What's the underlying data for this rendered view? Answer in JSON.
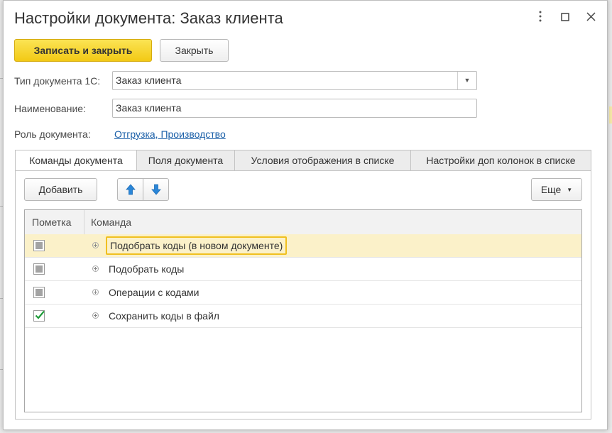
{
  "window": {
    "title": "Настройки документа: Заказ клиента",
    "more_icon": "vertical-dots",
    "maximize_icon": "square",
    "close_icon": "x"
  },
  "toolbar": {
    "save_close_label": "Записать и закрыть",
    "close_label": "Закрыть"
  },
  "form": {
    "doc_type_label": "Тип документа 1С:",
    "doc_type_value": "Заказ клиента",
    "name_label": "Наименование:",
    "name_value": "Заказ клиента",
    "role_label": "Роль документа:",
    "role_value": "Отгрузка, Производство"
  },
  "tabs": [
    {
      "label": "Команды документа",
      "active": true
    },
    {
      "label": "Поля документа",
      "active": false
    },
    {
      "label": "Условия отображения в списке",
      "active": false
    },
    {
      "label": "Настройки доп колонок в списке",
      "active": false
    }
  ],
  "commands_toolbar": {
    "add_label": "Добавить",
    "up_icon": "arrow-up",
    "down_icon": "arrow-down",
    "more_label": "Еще"
  },
  "grid": {
    "columns": [
      "Пометка",
      "Команда"
    ],
    "rows": [
      {
        "checked": false,
        "command": "Подобрать коды (в новом документе)",
        "selected": true
      },
      {
        "checked": false,
        "command": "Подобрать коды",
        "selected": false
      },
      {
        "checked": false,
        "command": "Операции с кодами",
        "selected": false
      },
      {
        "checked": true,
        "command": "Сохранить коды в файл",
        "selected": false
      }
    ]
  },
  "colors": {
    "primary_button": "#f5d125",
    "selected_row": "#fbf1c9",
    "focus_border": "#f0c020",
    "link": "#1a5fa8",
    "checkmark": "#1f9b3a",
    "arrow": "#2a86d8"
  }
}
